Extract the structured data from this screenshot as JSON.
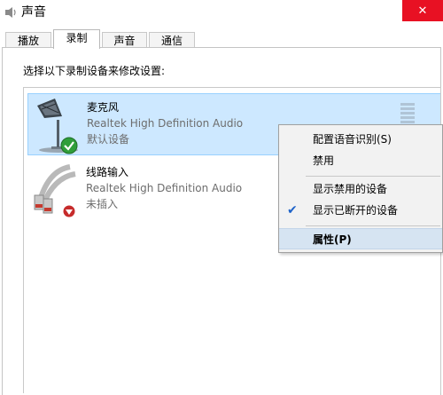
{
  "window": {
    "title": "声音",
    "close_glyph": "✕"
  },
  "tabs": [
    {
      "label": "播放",
      "active": false
    },
    {
      "label": "录制",
      "active": true
    },
    {
      "label": "声音",
      "active": false
    },
    {
      "label": "通信",
      "active": false
    }
  ],
  "instruction": "选择以下录制设备来修改设置:",
  "devices": [
    {
      "name": "麦克风",
      "driver": "Realtek High Definition Audio",
      "status": "默认设备",
      "icon": "microphone-icon",
      "badge": "default-check-badge",
      "selected": true
    },
    {
      "name": "线路输入",
      "driver": "Realtek High Definition Audio",
      "status": "未插入",
      "icon": "line-in-cable-icon",
      "badge": "unplugged-arrow-badge",
      "selected": false
    }
  ],
  "context_menu": {
    "items": [
      {
        "label": "配置语音识别(S)",
        "checked": false
      },
      {
        "label": "禁用",
        "checked": false
      },
      {
        "label": "显示禁用的设备",
        "checked": false
      },
      {
        "label": "显示已断开的设备",
        "checked": true
      },
      {
        "label": "属性(P)",
        "checked": false,
        "highlighted": true,
        "bold": true
      }
    ]
  },
  "colors": {
    "selected_row": "#cde8ff",
    "close_button": "#e81123",
    "menu_highlight": "#d6e4f2",
    "check_blue": "#1e63c9"
  }
}
